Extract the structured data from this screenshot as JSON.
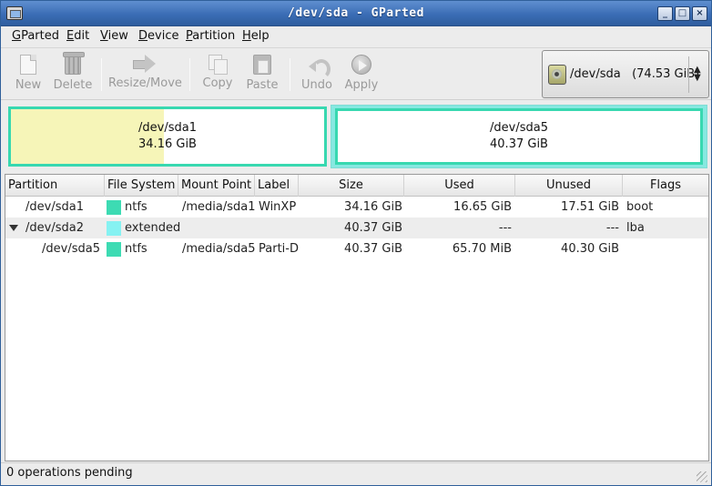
{
  "window": {
    "title": "/dev/sda - GParted",
    "controls": [
      "_",
      "□",
      "×"
    ]
  },
  "menu": [
    "GParted",
    "Edit",
    "View",
    "Device",
    "Partition",
    "Help"
  ],
  "toolbar": {
    "new": "New",
    "delete": "Delete",
    "resize_move": "Resize/Move",
    "copy": "Copy",
    "paste": "Paste",
    "undo": "Undo",
    "apply": "Apply"
  },
  "device": {
    "label": "/dev/sda   (74.53 GiB)"
  },
  "partition_map": {
    "sda1": {
      "name": "/dev/sda1",
      "size": "34.16 GiB",
      "used_fraction": 0.487,
      "color": "#38d8b0",
      "used_color": "#f6f5b8"
    },
    "sda5": {
      "name": "/dev/sda5",
      "size": "40.37 GiB",
      "color": "#38d8b0"
    },
    "extended_color": "#86e8e0"
  },
  "table": {
    "headers": [
      "Partition",
      "File System",
      "Mount Point",
      "Label",
      "Size",
      "Used",
      "Unused",
      "Flags"
    ],
    "rows": [
      {
        "partition": "/dev/sda1",
        "fs": "ntfs",
        "fs_color": "#3ddbb3",
        "mount": "/media/sda1",
        "label": "WinXP",
        "size": "34.16 GiB",
        "used": "16.65 GiB",
        "unused": "17.51 GiB",
        "flags": "boot"
      },
      {
        "partition": "/dev/sda2",
        "fs": "extended",
        "fs_color": "#86f2f2",
        "mount": "",
        "label": "",
        "size": "40.37 GiB",
        "used": "---",
        "unused": "---",
        "flags": "lba"
      },
      {
        "partition": "/dev/sda5",
        "fs": "ntfs",
        "fs_color": "#3ddbb3",
        "mount": "/media/sda5",
        "label": "Parti-D",
        "size": "40.37 GiB",
        "used": "65.70 MiB",
        "unused": "40.30 GiB",
        "flags": ""
      }
    ]
  },
  "status": {
    "text": "0 operations pending"
  }
}
